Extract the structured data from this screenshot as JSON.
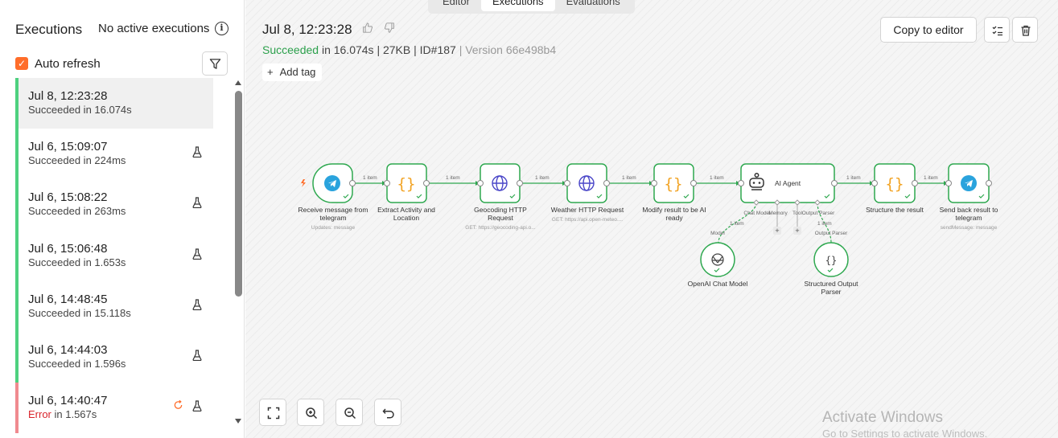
{
  "sidebar": {
    "title": "Executions",
    "no_active": "No active executions",
    "info_icon": "i",
    "auto_refresh": "Auto refresh",
    "executions": [
      {
        "time": "Jul 8, 12:23:28",
        "status_word": "Succeeded",
        "duration": " in 16.074s",
        "selected": true
      },
      {
        "time": "Jul 6, 15:09:07",
        "status_word": "Succeeded",
        "duration": " in 224ms"
      },
      {
        "time": "Jul 6, 15:08:22",
        "status_word": "Succeeded",
        "duration": " in 263ms"
      },
      {
        "time": "Jul 6, 15:06:48",
        "status_word": "Succeeded",
        "duration": " in 1.653s"
      },
      {
        "time": "Jul 6, 14:48:45",
        "status_word": "Succeeded",
        "duration": " in 15.118s"
      },
      {
        "time": "Jul 6, 14:44:03",
        "status_word": "Succeeded",
        "duration": " in 1.596s"
      },
      {
        "time": "Jul 6, 14:40:47",
        "status_word": "Error",
        "duration": " in 1.567s",
        "error": true
      }
    ]
  },
  "tabs": [
    "Editor",
    "Executions",
    "Evaluations"
  ],
  "execution": {
    "title": "Jul 8, 12:23:28",
    "status": "Succeeded",
    "duration": " in 16.074s",
    "size": " | 27KB | ",
    "id": "ID#187",
    "version": " | Version 66e498b4",
    "add_tag": "Add tag",
    "copy_to_editor": "Copy to editor"
  },
  "nodes": {
    "telegram_trigger": {
      "label1": "Receive message from",
      "label2": "telegram",
      "sub": "Updates: message"
    },
    "extract": {
      "label1": "Extract Activity and",
      "label2": "Location"
    },
    "geocoding": {
      "label1": "Geocoding HTTP",
      "label2": "Request",
      "sub": "GET: https://geocoding-api.o..."
    },
    "weather": {
      "label1": "Weather HTTP Request",
      "sub": "GET: https://api.open-meteo...."
    },
    "modify": {
      "label1": "Modify result to be AI",
      "label2": "ready"
    },
    "agent": {
      "label": "AI Agent",
      "port_chat": "Chat Model",
      "port_memory": "Memory",
      "port_tool": "Tool",
      "port_parser": "Output Parser"
    },
    "structure": {
      "label1": "Structure the result"
    },
    "send": {
      "label1": "Send back result to",
      "label2": "telegram",
      "sub": "sendMessage: message"
    },
    "openai": {
      "label1": "OpenAI Chat Model",
      "link": "Model"
    },
    "parser": {
      "label1": "Structured Output",
      "label2": "Parser",
      "link": "Output Parser"
    }
  },
  "edge_label": "1 item",
  "plus": "+",
  "watermark": {
    "line1": "Activate Windows",
    "line2": "Go to Settings to activate Windows."
  },
  "colors": {
    "accent": "#ff6d2a",
    "success": "#2ca04c",
    "node_green": "#2ea84f",
    "error": "#d9242c",
    "telegram": "#2aa3dd",
    "globe": "#4a46c8",
    "code": "#f2a323"
  }
}
